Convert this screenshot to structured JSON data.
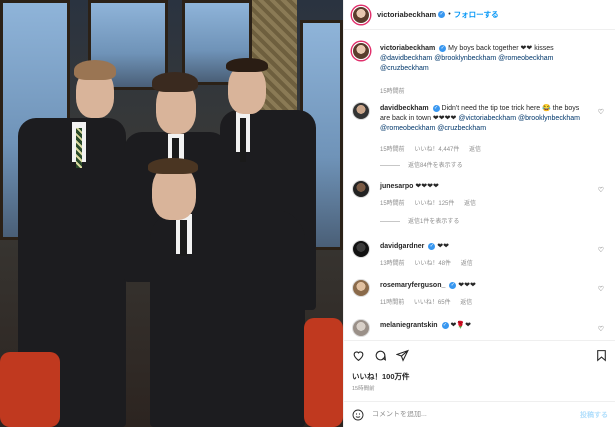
{
  "header": {
    "username": "victoriabeckham",
    "follow_label": "フォローする"
  },
  "caption": {
    "username": "victoriabeckham",
    "text": "My boys back together ❤❤ kisses",
    "mentions": "@davidbeckham @brooklynbeckham @romeobeckham @cruzbeckham",
    "time": "15時間前"
  },
  "comments": [
    {
      "username": "davidbeckham",
      "text": "Didn't need the tip toe trick here 😂 the boys are back in town ❤❤❤❤",
      "mentions": "@victoriabeckham @brooklynbeckham @romeobeckham @cruzbeckham",
      "time": "15時間前",
      "likes": "いいね！4,447件",
      "reply": "返信",
      "view_replies": "返信84件を表示する"
    },
    {
      "username": "junesarpo",
      "text": "❤❤❤❤",
      "time": "15時間前",
      "likes": "いいね！125件",
      "reply": "返信",
      "view_replies": "返信1件を表示する"
    },
    {
      "username": "davidgardner",
      "text": "❤❤",
      "time": "13時間前",
      "likes": "いいね！48件",
      "reply": "返信"
    },
    {
      "username": "rosemaryferguson_",
      "text": "❤❤❤",
      "time": "11時間前",
      "likes": "いいね！65件",
      "reply": "返信"
    },
    {
      "username": "melaniegrantskin",
      "text": "❤🌹❤"
    }
  ],
  "actions": {
    "likes": "いいね！100万件",
    "time": "15時間前"
  },
  "add_comment": {
    "placeholder": "コメントを追加...",
    "post_label": "投稿する"
  },
  "colors": {
    "accent": "#0095f6",
    "verified": "#3897f0",
    "muted": "#8e8e8e"
  }
}
